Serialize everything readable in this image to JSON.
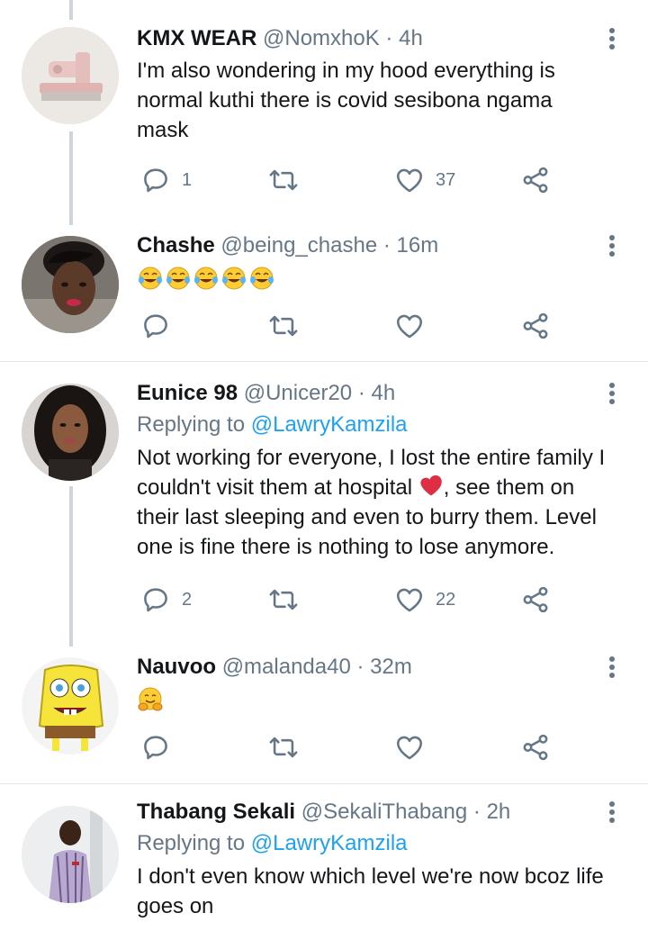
{
  "tweets": [
    {
      "name": "KMX WEAR",
      "handle": "@NomxhoK",
      "dot": "·",
      "time": "4h",
      "lines": [
        "I'm also wondering in my hood everything is",
        "normal kuthi there is covid sesibona ngama",
        "mask"
      ],
      "replies": "1",
      "retweets": "",
      "likes": "37"
    },
    {
      "name": "Chashe",
      "handle": "@being_chashe",
      "dot": "·",
      "time": "16m",
      "emojis": [
        "face-with-tears-of-joy",
        "face-with-tears-of-joy",
        "face-with-tears-of-joy",
        "face-with-tears-of-joy",
        "face-with-tears-of-joy"
      ],
      "replies": "",
      "retweets": "",
      "likes": ""
    },
    {
      "name": "Eunice 98",
      "handle": "@Unicer20",
      "dot": "·",
      "time": "4h",
      "replying_label": "Replying to",
      "replying_to": "@LawryKamzila",
      "lines": [
        "Not working for everyone,  I lost the entire family I",
        "couldn't visit them at hospital",
        ",  see them on",
        "their last sleeping and even to burry them. Level",
        "one is fine there is nothing to lose anymore."
      ],
      "inline_emoji": "broken-heart",
      "replies": "2",
      "retweets": "",
      "likes": "22"
    },
    {
      "name": "Nauvoo",
      "handle": "@malanda40",
      "dot": "·",
      "time": "32m",
      "emojis": [
        "hugging-face"
      ],
      "replies": "",
      "retweets": "",
      "likes": ""
    },
    {
      "name": "Thabang Sekali",
      "handle": "@SekaliThabang",
      "dot": "·",
      "time": "2h",
      "replying_label": "Replying to",
      "replying_to": "@LawryKamzila",
      "lines": [
        "I don't even know which level we're now bcoz life",
        "goes on"
      ]
    }
  ],
  "colors": {
    "text": "#14171a",
    "secondary": "#657786",
    "link": "#1da1f2",
    "divider": "#e1e8ed",
    "thread": "#ccd6dd"
  }
}
